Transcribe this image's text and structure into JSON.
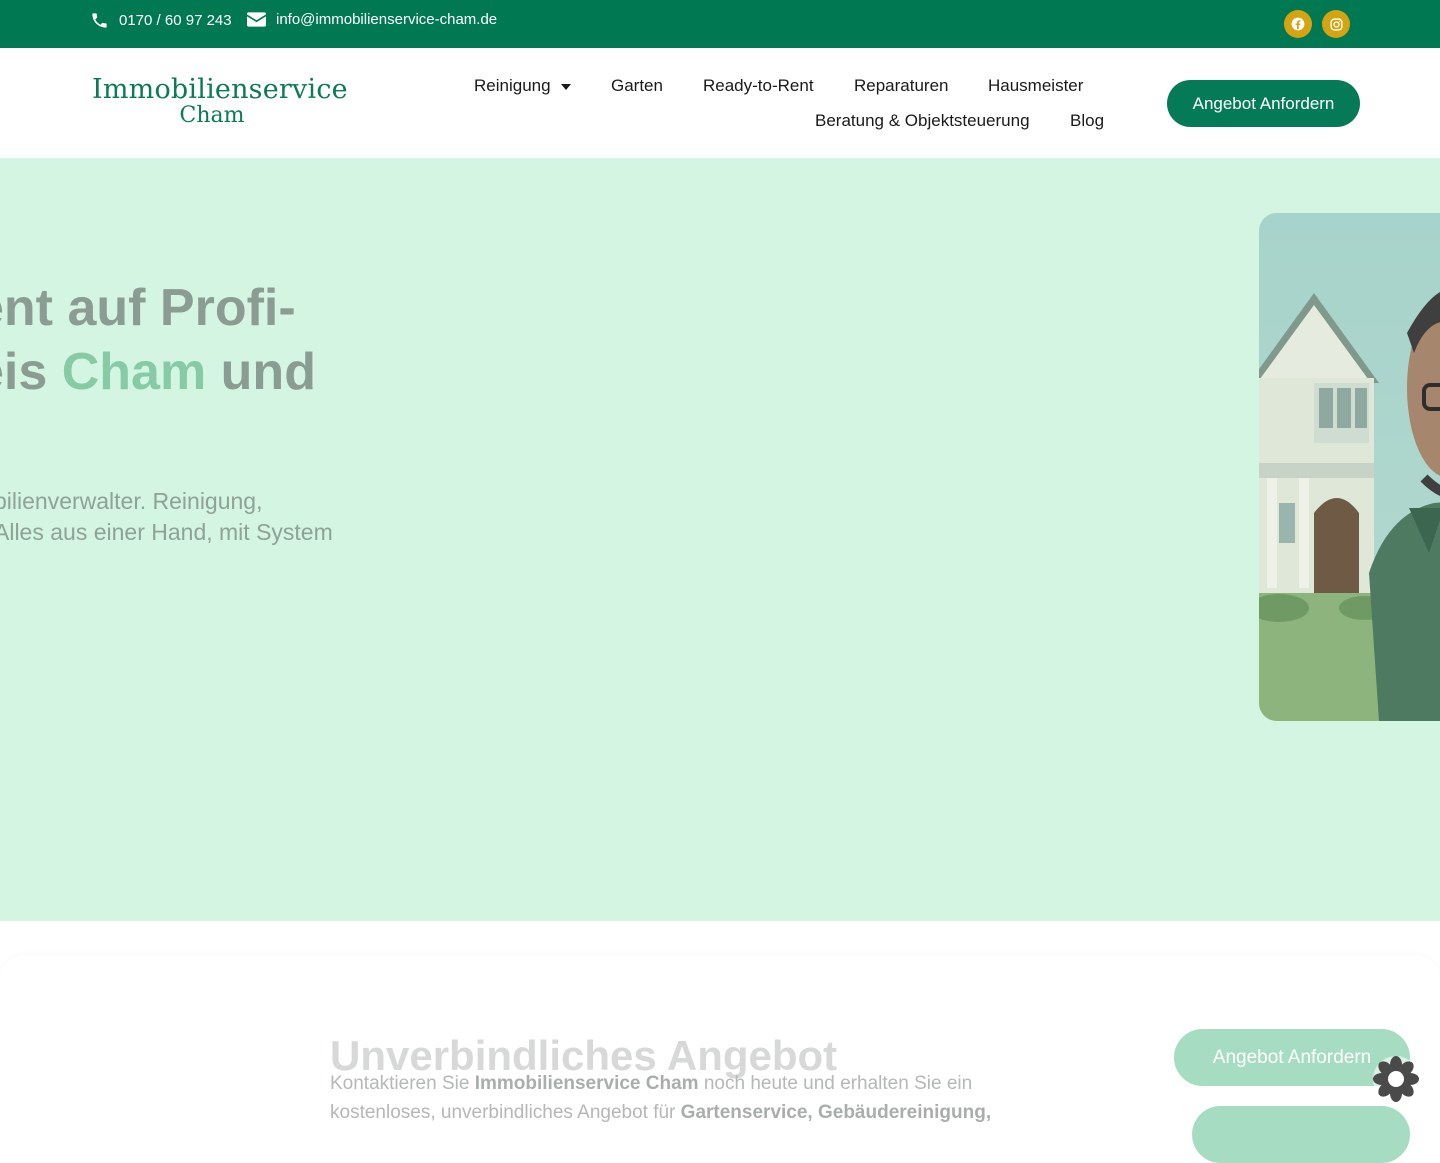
{
  "topbar": {
    "phone": "0170 / 60 97 243",
    "email": "info@immobilienservice-cham.de",
    "social": [
      {
        "icon": "facebook-icon"
      },
      {
        "icon": "instagram-icon"
      }
    ]
  },
  "header": {
    "logo": {
      "line1": "Immobilienservice",
      "line2": "Cham"
    },
    "nav": {
      "row1": [
        "Reinigung",
        "Garten",
        "Ready-to-Rent",
        "Reparaturen",
        "Hausmeister"
      ],
      "row2": [
        "Beratung & Objektsteuerung",
        "Blog"
      ]
    },
    "cta": "Angebot Anfordern"
  },
  "hero": {
    "title_line1": "ent auf Profi-",
    "title_line2_a": "eis ",
    "title_line2_accent": "Cham",
    "title_line2_b": " und",
    "subtitle_line1": "bilienverwalter. Reinigung,",
    "subtitle_line2": "Alles aus einer Hand, mit System"
  },
  "offer": {
    "title": "Unverbindliches Angebot",
    "text_1": "Kontaktieren Sie ",
    "text_bold_1": "Immobilienservice Cham",
    "text_2": " noch heute und erhalten Sie ein kostenloses, unverbindliches Angebot für ",
    "text_bold_2": "Gartenservice, Gebäudereinigung,",
    "cta": "Angebot Anfordern"
  },
  "colors": {
    "primary": "#007852",
    "gold": "#d4a411",
    "hero_bg": "#d4f5e2",
    "accent": "#86cba6"
  }
}
